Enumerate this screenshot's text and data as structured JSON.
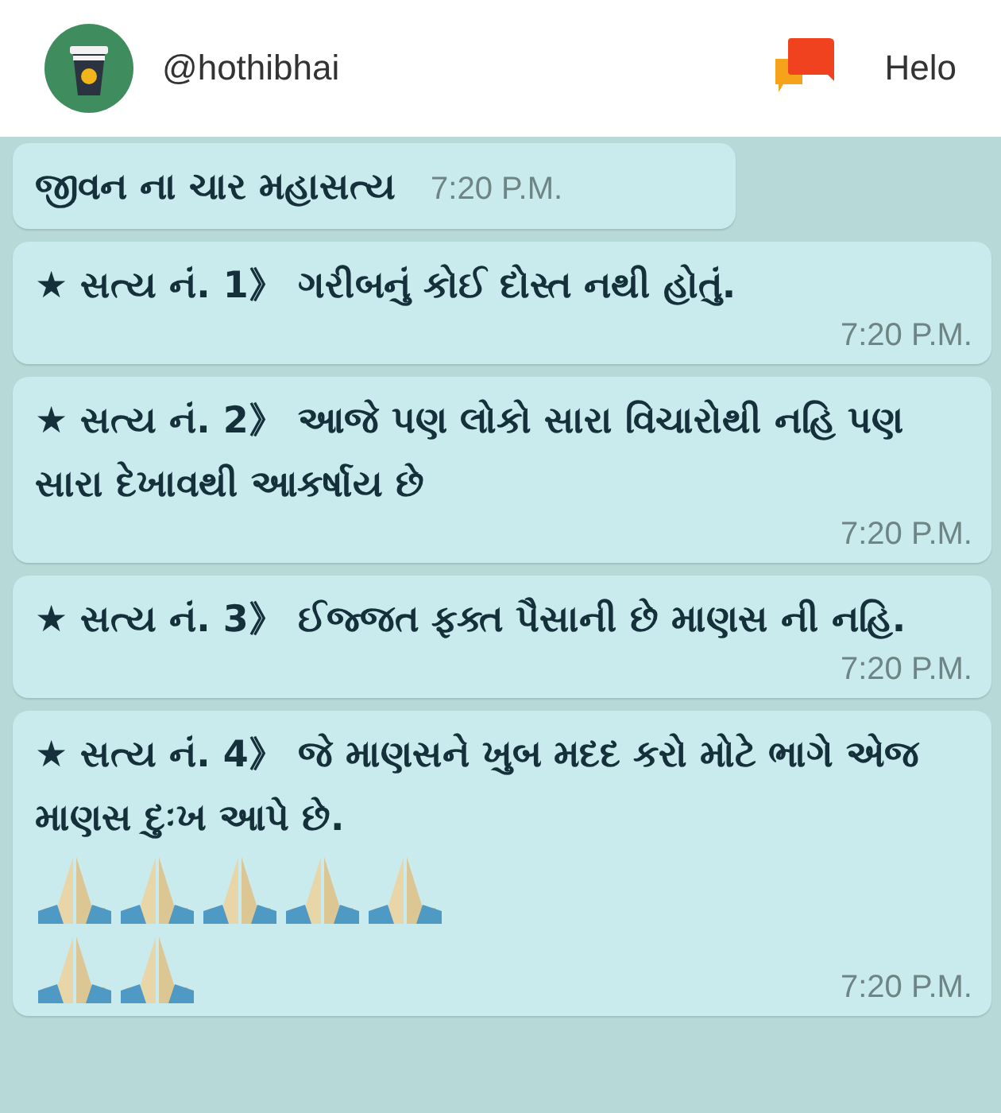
{
  "header": {
    "username": "@hothibhai",
    "app_name": "Helo"
  },
  "messages": [
    {
      "text": "જીવન ના ચાર મહાસત્ય",
      "time": "7:20 P.M.",
      "kind": "title"
    },
    {
      "text": "★ સત્ય નં. 1》  ગરીબનું કોઈ દોસ્ત નથી હોતું.",
      "time": "7:20 P.M.",
      "kind": "body"
    },
    {
      "text": "★ સત્ય નં. 2》  આજે પણ લોકો સારા વિચારોથી નહિ પણ સારા દેખાવથી આકર્ષાય છે",
      "time": "7:20 P.M.",
      "kind": "body"
    },
    {
      "text": "★ સત્ય નં. 3》  ઈજ્જત ફક્ત પૈસાની છે માણસ ની નહિ.",
      "time": "7:20 P.M.",
      "kind": "body"
    },
    {
      "text": "★ સત્ય નં. 4》  જે માણસને ખુબ મદદ કરો મોટે ભાગે એજ માણસ દુઃખ આપે છે.",
      "time": "7:20 P.M.",
      "kind": "body",
      "icons": [
        {
          "kind": "praying-hands"
        },
        {
          "kind": "praying-hands"
        },
        {
          "kind": "praying-hands"
        },
        {
          "kind": "praying-hands"
        },
        {
          "kind": "praying-hands"
        },
        {
          "kind": "praying-hands"
        },
        {
          "kind": "praying-hands"
        }
      ]
    }
  ]
}
